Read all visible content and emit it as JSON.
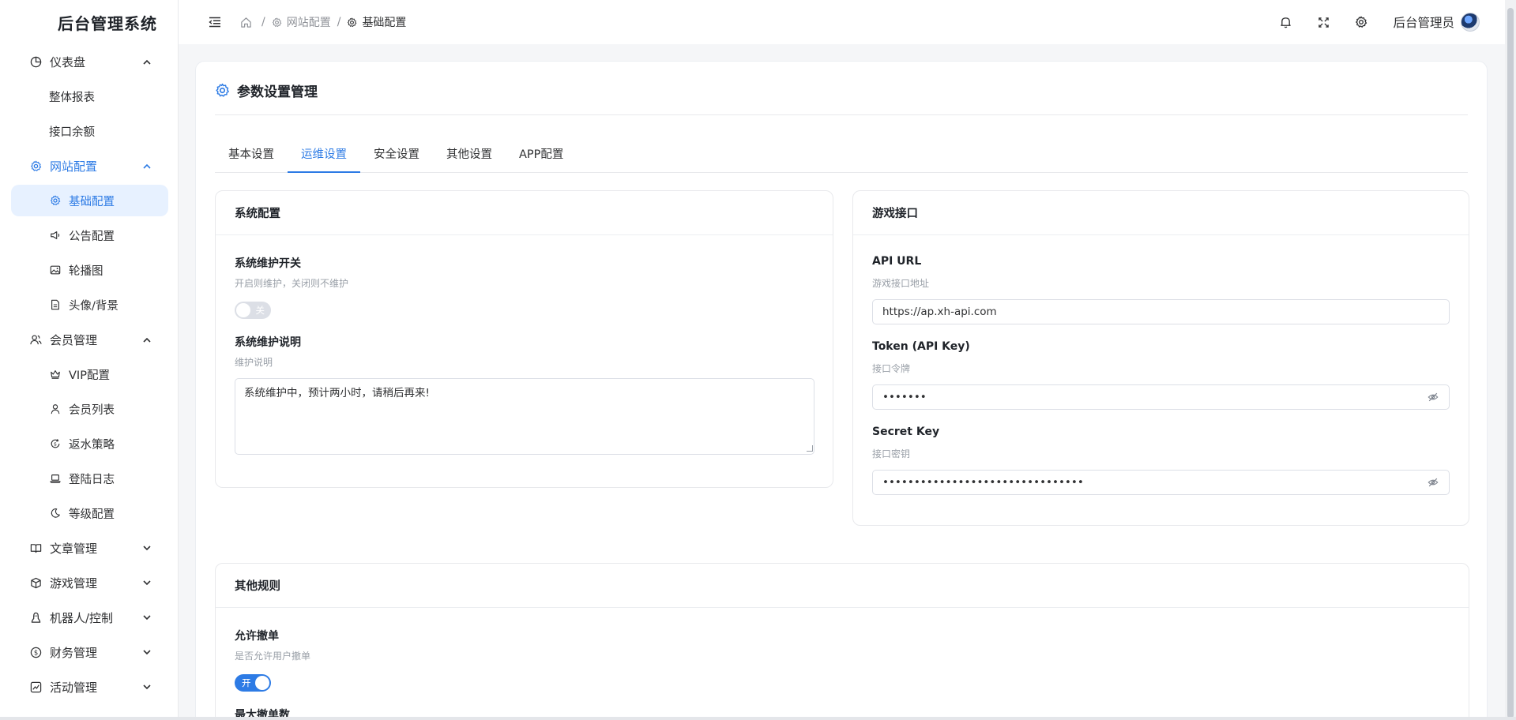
{
  "app": {
    "title": "后台管理系统"
  },
  "sidebar": {
    "groups": [
      {
        "label": "仪表盘",
        "icon": "pie-chart-icon",
        "expanded": true,
        "items": [
          {
            "label": "整体报表"
          },
          {
            "label": "接口余额"
          }
        ]
      },
      {
        "label": "网站配置",
        "icon": "gear-icon",
        "expanded": true,
        "active": true,
        "items": [
          {
            "label": "基础配置",
            "icon": "gear-icon",
            "active": true
          },
          {
            "label": "公告配置",
            "icon": "speaker-icon"
          },
          {
            "label": "轮播图",
            "icon": "image-icon"
          },
          {
            "label": "头像/背景",
            "icon": "file-icon"
          }
        ]
      },
      {
        "label": "会员管理",
        "icon": "users-icon",
        "expanded": true,
        "items": [
          {
            "label": "VIP配置",
            "icon": "crown-icon"
          },
          {
            "label": "会员列表",
            "icon": "user-icon"
          },
          {
            "label": "返水策略",
            "icon": "refresh-money-icon"
          },
          {
            "label": "登陆日志",
            "icon": "laptop-icon"
          },
          {
            "label": "等级配置",
            "icon": "moon-icon"
          }
        ]
      },
      {
        "label": "文章管理",
        "icon": "book-icon",
        "expanded": false
      },
      {
        "label": "游戏管理",
        "icon": "cube-icon",
        "expanded": false
      },
      {
        "label": "机器人/控制",
        "icon": "robot-icon",
        "expanded": false
      },
      {
        "label": "财务管理",
        "icon": "dollar-icon",
        "expanded": false
      },
      {
        "label": "活动管理",
        "icon": "chart-icon",
        "expanded": false
      }
    ]
  },
  "header": {
    "breadcrumb": [
      "网站配置",
      "基础配置"
    ],
    "username": "后台管理员"
  },
  "page": {
    "title": "参数设置管理",
    "tabs": [
      {
        "label": "基本设置"
      },
      {
        "label": "运维设置",
        "active": true
      },
      {
        "label": "安全设置"
      },
      {
        "label": "其他设置"
      },
      {
        "label": "APP配置"
      }
    ]
  },
  "system_config": {
    "title": "系统配置",
    "maintenance_switch": {
      "label": "系统维护开关",
      "hint": "开启则维护，关闭则不维护",
      "state": "关"
    },
    "maintenance_note": {
      "label": "系统维护说明",
      "hint": "维护说明",
      "value": "系统维护中，预计两小时，请稍后再来!"
    }
  },
  "game_api": {
    "title": "游戏接口",
    "api_url": {
      "label": "API URL",
      "hint": "游戏接口地址",
      "value": "https://ap.xh-api.com"
    },
    "token": {
      "label": "Token (API Key)",
      "hint": "接口令牌",
      "value": "•••••••"
    },
    "secret": {
      "label": "Secret Key",
      "hint": "接口密钥",
      "value": "••••••••••••••••••••••••••••••••"
    }
  },
  "other_rules": {
    "title": "其他规则",
    "allow_cancel": {
      "label": "允许撤单",
      "hint": "是否允许用户撤单",
      "state": "开"
    },
    "max_cancel": {
      "label": "最大撤单数"
    }
  },
  "colors": {
    "accent": "#2d7be5",
    "active_bg": "#e7f1ff",
    "text": "#303133",
    "hint": "#9aa0a8"
  }
}
